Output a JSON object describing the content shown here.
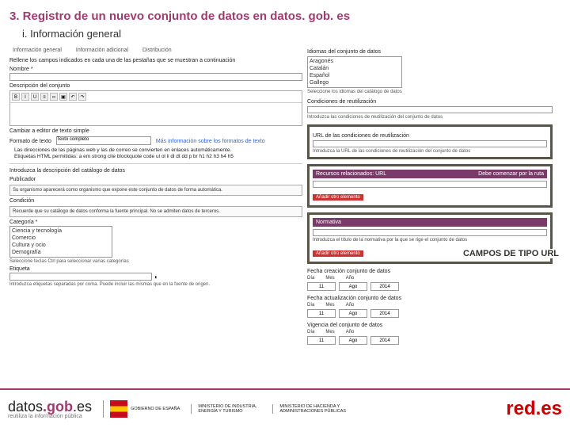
{
  "title": "3. Registro de un nuevo conjunto de datos en datos. gob. es",
  "subtitle": "i. Información general",
  "tabs": {
    "t1": "Información general",
    "t2": "Información adicional",
    "t3": "Distribución"
  },
  "intro": "Rellene los campos indicados en cada una de las pestañas que se muestran a continuación",
  "fields": {
    "nombre": "Nombre *",
    "descripcion": "Descripción del conjunto",
    "introdesc": "Introduzca la descripción del catálogo de datos",
    "publicador": "Publicador",
    "publicador_note": "Su organismo aparecerá como organismo que expone este conjunto de datos de forma automática.",
    "condicion": "Condición",
    "condicion_note": "Recuerde que su catálogo de datos conforma la fuente principal. No se admiten datos de terceros.",
    "categoria": "Categoría *",
    "cat1": "Ciencia y tecnología",
    "cat2": "Comercio",
    "cat3": "Cultura y ocio",
    "cat4": "Demografía",
    "categoria_note": "Seleccione teclas Ctrl para seleccionar varias categorías",
    "etiqueta": "Etiqueta",
    "etiqueta_note": "Introduzca etiquetas separadas por coma. Puede incluir las mismas que en la fuente de origen."
  },
  "rte_bullets": {
    "b1": "Las direcciones de las páginas web y las de correo se convierten en enlaces automáticamente.",
    "b2": "Etiquetas HTML permitidas: a em strong cite blockquote code ul ol li dl dt dd p br h1 h2 h3 h4 h5",
    "switch": "Cambiar a editor de texto simple",
    "format_label": "Formato de texto",
    "format_value": "Texto completo",
    "more": "Más información sobre los formatos de texto"
  },
  "right": {
    "idiomas": "Idiomas del conjunto de datos",
    "lang1": "Aragonés",
    "lang2": "Catalán",
    "lang3": "Español",
    "lang4": "Gallego",
    "idiomas_note": "Seleccione los idiomas del catálogo de datos",
    "cond_reut": "Condiciones de reutilización",
    "cond_note": "Introduzca las condiciones de reutilización del conjunto de datos",
    "url_cond": "URL de las condiciones de reutilización",
    "url_cond_note": "Introduzca la URL de las condiciones de reutilización del conjunto de datos",
    "recursos": "Recursos relacionados: URL",
    "recursos_note": "Debe comenzar por la ruta",
    "anadir": "Añadir otro elemento",
    "normativa": "Normativa",
    "normativa_note": "Introduzca el título de la normativa por la que se rige el conjunto de datos",
    "fecha_crea": "Fecha creación conjunto de datos",
    "fecha_act": "Fecha actualización conjunto de datos",
    "vigencia": "Vigencia del conjunto de datos",
    "dia": "Día",
    "mes": "Mes",
    "ano": "Año",
    "d": "11",
    "m": "Ago",
    "y": "2014"
  },
  "callout": "CAMPOS DE TIPO URL",
  "footer": {
    "datos": "datos",
    "gob": ".gob",
    "es": ".es",
    "tagline": "reutiliza la información pública",
    "gob_es": "GOBIERNO DE ESPAÑA",
    "min1": "MINISTERIO DE INDUSTRIA, ENERGÍA Y TURISMO",
    "min2": "MINISTERIO DE HACIENDA Y ADMINISTRACIONES PÚBLICAS",
    "red": "red",
    "redes": ".es"
  }
}
